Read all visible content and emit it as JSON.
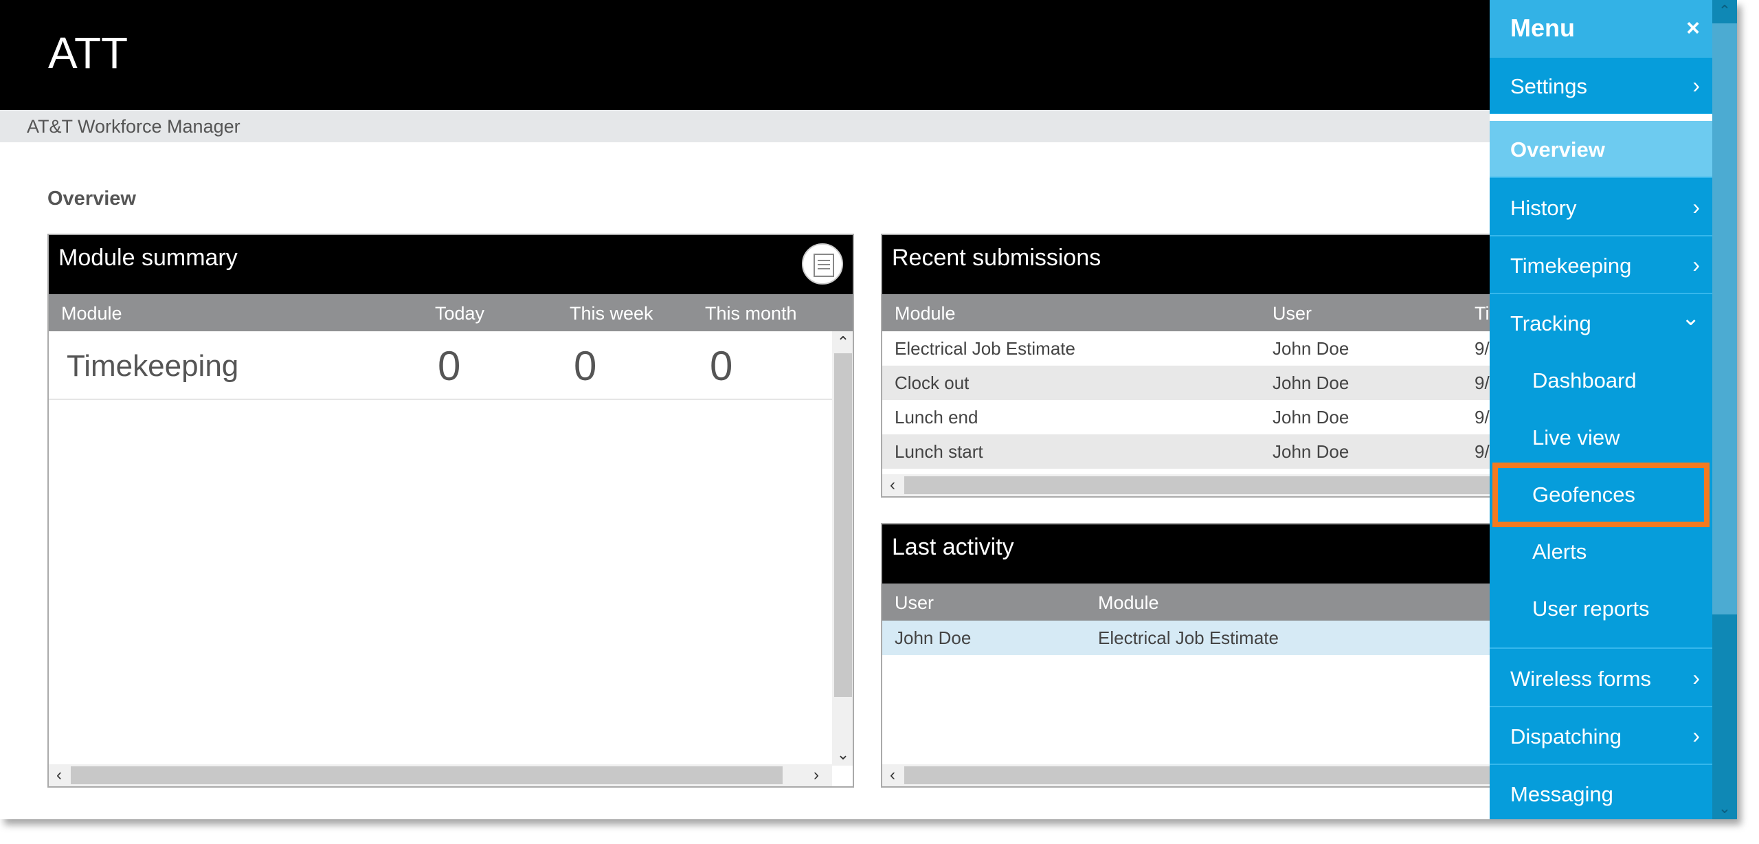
{
  "header": {
    "brand": "ATT",
    "subtitle": "AT&T Workforce Manager"
  },
  "page": {
    "title": "Overview"
  },
  "module_summary": {
    "title": "Module summary",
    "columns": [
      "Module",
      "Today",
      "This week",
      "This month"
    ],
    "rows": [
      {
        "module": "Timekeeping",
        "today": "0",
        "week": "0",
        "month": "0"
      }
    ]
  },
  "recent_submissions": {
    "title": "Recent submissions",
    "columns": [
      "Module",
      "User",
      "Ti"
    ],
    "rows": [
      {
        "module": "Electrical Job Estimate",
        "user": "John Doe",
        "time": "9/"
      },
      {
        "module": "Clock out",
        "user": "John Doe",
        "time": "9/"
      },
      {
        "module": "Lunch end",
        "user": "John Doe",
        "time": "9/"
      },
      {
        "module": "Lunch start",
        "user": "John Doe",
        "time": "9/"
      }
    ]
  },
  "last_activity": {
    "title": "Last activity",
    "columns": [
      "User",
      "Module"
    ],
    "rows": [
      {
        "user": "John Doe",
        "module": "Electrical Job Estimate"
      }
    ]
  },
  "menu": {
    "title": "Menu",
    "close": "×",
    "items": [
      {
        "label": "Settings",
        "chevron": "›"
      },
      {
        "label": "Overview"
      },
      {
        "label": "History",
        "chevron": "›"
      },
      {
        "label": "Timekeeping",
        "chevron": "›"
      },
      {
        "label": "Tracking",
        "chevron": "⌄"
      },
      {
        "label": "Dashboard"
      },
      {
        "label": "Live view"
      },
      {
        "label": "Geofences"
      },
      {
        "label": "Alerts"
      },
      {
        "label": "User reports"
      },
      {
        "label": "Wireless forms",
        "chevron": "›"
      },
      {
        "label": "Dispatching",
        "chevron": "›"
      },
      {
        "label": "Messaging"
      }
    ]
  },
  "icons": {
    "document": "document-icon",
    "close": "close-icon"
  },
  "colors": {
    "menu_bg": "#069ddb",
    "highlight": "#f47a1f",
    "header_bg": "#000000"
  }
}
